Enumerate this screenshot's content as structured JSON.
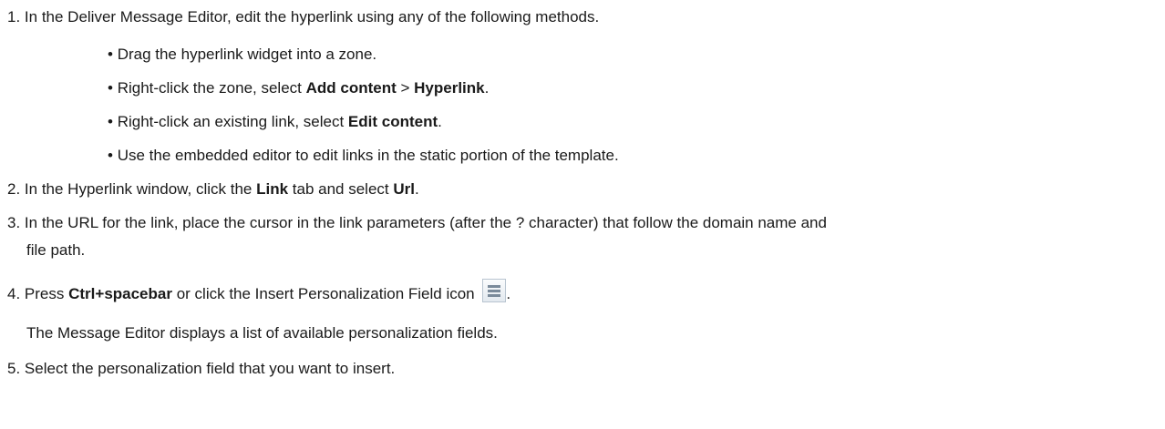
{
  "steps": [
    {
      "number": "1.",
      "text": "In the Deliver Message Editor, edit the hyperlink using any of the following methods.",
      "bullets": [
        {
          "marker": "•",
          "pre": "Drag the hyperlink widget into a zone."
        },
        {
          "marker": "•",
          "pre": "Right-click the zone, select ",
          "b1": "Add content",
          "mid": " > ",
          "b2": "Hyperlink",
          "post": "."
        },
        {
          "marker": "•",
          "pre": "Right-click an existing link, select ",
          "b1": "Edit content",
          "post": "."
        },
        {
          "marker": "•",
          "pre": "Use the embedded editor to edit links in the static portion of the template."
        }
      ]
    },
    {
      "number": "2.",
      "pre": "In the Hyperlink window, click the ",
      "b1": "Link",
      "mid": " tab and select ",
      "b2": "Url",
      "post": "."
    },
    {
      "number": "3.",
      "line1": "In the URL for the link, place the cursor in the link parameters (after the ? character) that follow the domain name and",
      "line2": "file path."
    },
    {
      "number": "4.",
      "pre": "Press ",
      "b1": "Ctrl+spacebar",
      "mid": " or click the Insert Personalization Field icon ",
      "post": ".",
      "icon": "insert-personalization-field-icon",
      "result": "The Message Editor displays a list of available personalization fields."
    },
    {
      "number": "5.",
      "text": "Select the personalization field that you want to insert."
    }
  ]
}
